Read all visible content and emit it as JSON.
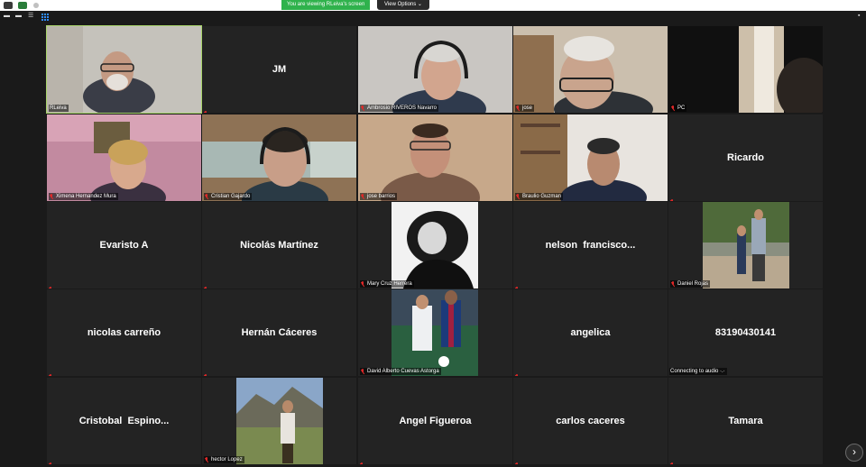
{
  "banner": {
    "viewing_text": "You are viewing RLeiva's screen",
    "view_options_label": "View Options",
    "view_options_caret": "⌄"
  },
  "window_controls": {
    "minimize": "▬",
    "restore": "▬",
    "menu": "☰"
  },
  "next_page_icon": "›",
  "participants": [
    {
      "name": "RLeiva",
      "display": ""
    },
    {
      "name": "",
      "display": "JM"
    },
    {
      "name": "Ambrosio RIVEROS Navarro",
      "display": ""
    },
    {
      "name": "jose",
      "display": ""
    },
    {
      "name": "PC",
      "display": ""
    },
    {
      "name": "Ximena Hernandez Mura",
      "display": ""
    },
    {
      "name": "Cristian Gajardo",
      "display": ""
    },
    {
      "name": "jose barrios",
      "display": ""
    },
    {
      "name": "Braulio Guzman",
      "display": ""
    },
    {
      "name": "",
      "display": "Ricardo"
    },
    {
      "name": "",
      "display": "Evaristo A"
    },
    {
      "name": "",
      "display": "Nicolás Martínez"
    },
    {
      "name": "Mary Cruz Herrera",
      "display": ""
    },
    {
      "name": "",
      "display": "nelson  francisco..."
    },
    {
      "name": "Daniel Rojas",
      "display": ""
    },
    {
      "name": "",
      "display": "nicolas carreño"
    },
    {
      "name": "",
      "display": "Hernán Cáceres"
    },
    {
      "name": "David Alberto Cuevas Astorga",
      "display": ""
    },
    {
      "name": "",
      "display": "angelica"
    },
    {
      "name": "Connecting to audio ·.·",
      "display": "83190430141"
    },
    {
      "name": "",
      "display": "Cristobal  Espino..."
    },
    {
      "name": "hector Lopez",
      "display": ""
    },
    {
      "name": "",
      "display": "Angel Figueroa"
    },
    {
      "name": "",
      "display": "carlos caceres"
    },
    {
      "name": "",
      "display": "Tamara"
    }
  ]
}
